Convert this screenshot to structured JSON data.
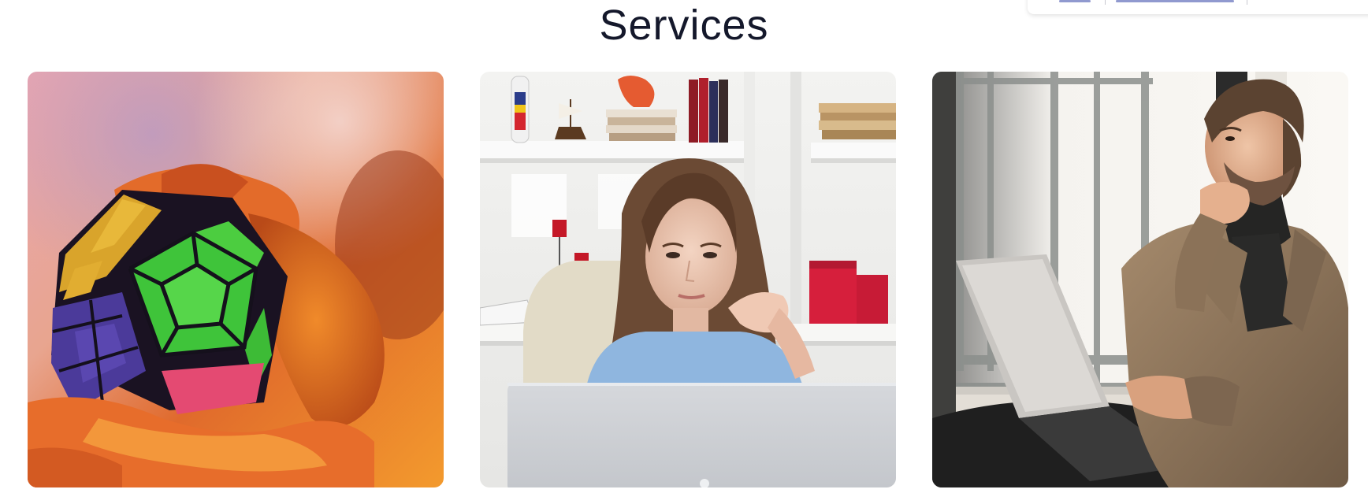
{
  "section": {
    "title": "Services"
  },
  "cards": [
    {
      "image": "megaminx-puzzle-in-hands-photo"
    },
    {
      "image": "woman-thinking-at-laptop-photo"
    },
    {
      "image": "man-thinking-at-laptop-photo"
    }
  ],
  "colors": {
    "title_text": "#14182b",
    "background": "#ffffff"
  }
}
